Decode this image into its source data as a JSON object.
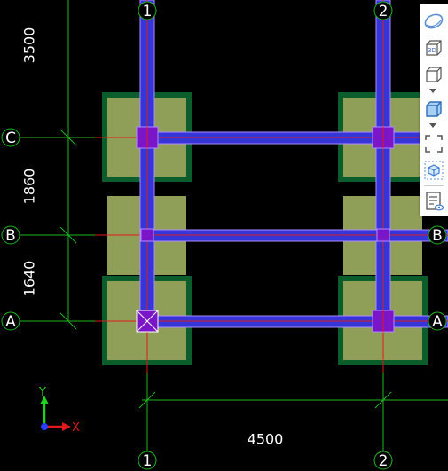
{
  "colors": {
    "background": "#000000",
    "axis_line": "#1db81d",
    "beam_fill": "#3535d8",
    "beam_edge": "#b08cff",
    "column_fill": "#7a16c8",
    "footing_fill": "#8f9f58",
    "footing_border": "#0b5e2c",
    "red_line": "#e01a1a",
    "text": "#ffffff",
    "toolbar_bg": "#ffffff",
    "toolbar_icon": "#5a8fd0"
  },
  "axes": {
    "vertical": [
      {
        "id": "1",
        "label_top": "1",
        "label_bottom": "1"
      },
      {
        "id": "2",
        "label_top": "2",
        "label_bottom": "2"
      }
    ],
    "horizontal": [
      {
        "id": "C",
        "label_left": "C",
        "label_right": ""
      },
      {
        "id": "B",
        "label_left": "B",
        "label_right": "B"
      },
      {
        "id": "A",
        "label_left": "A",
        "label_right": "A"
      }
    ]
  },
  "dimensions": {
    "left": [
      "3500",
      "1860",
      "1640"
    ],
    "bottom": "4500"
  },
  "ucs": {
    "x_label": "X",
    "y_label": "Y"
  },
  "toolbar": {
    "items": [
      {
        "name": "orbit-icon",
        "label": ""
      },
      {
        "name": "view-3d-icon",
        "label": "3D"
      },
      {
        "name": "view-cube-icon",
        "label": ""
      },
      {
        "name": "display-cube-icon",
        "label": ""
      },
      {
        "name": "zoom-extents-icon",
        "label": ""
      },
      {
        "name": "view-mode-icon",
        "label": ""
      },
      {
        "name": "properties-panel-icon",
        "label": ""
      }
    ]
  }
}
